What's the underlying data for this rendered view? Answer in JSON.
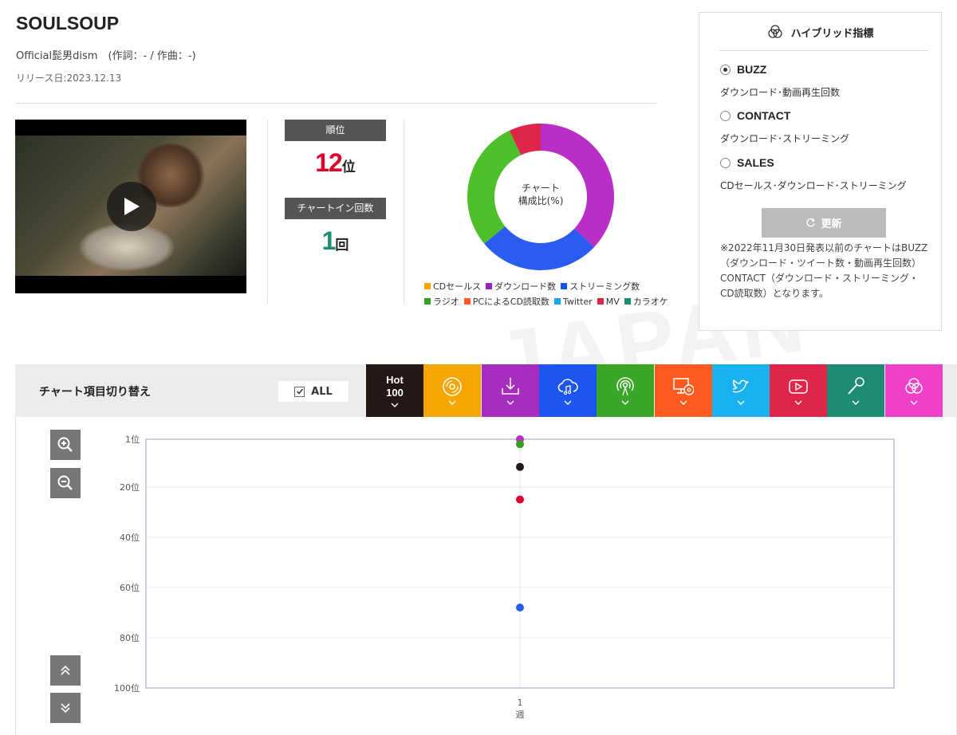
{
  "song": {
    "title": "SOULSOUP",
    "artist_line": "Official髭男dism　(作詞：- / 作曲：-)",
    "release": "リリース日:2023.12.13"
  },
  "video": {
    "icon": "play-icon"
  },
  "rank": {
    "label": "順位",
    "value": "12",
    "unit": "位",
    "value_color": "#e0002c",
    "chartin_label": "チャートイン回数",
    "chartin_value": "1",
    "chartin_unit": "回",
    "chartin_color": "#1c8c74"
  },
  "donut": {
    "center_line1": "チャート",
    "center_line2": "構成比(%)",
    "segments": [
      {
        "name": "ダウンロード数",
        "color": "#b82ec6",
        "value": 37
      },
      {
        "name": "ストリーミング数",
        "color": "#2a5cf0",
        "value": 27
      },
      {
        "name": "ラジオ",
        "color": "#4cbf2b",
        "value": 29
      },
      {
        "name": "MV",
        "color": "#e0254a",
        "value": 7
      }
    ]
  },
  "legend": {
    "row1": [
      {
        "label": "CDセールス",
        "color": "#f7a500"
      },
      {
        "label": "ダウンロード数",
        "color": "#a020c0"
      },
      {
        "label": "ストリーミング数",
        "color": "#1452f0"
      }
    ],
    "row2": [
      {
        "label": "ラジオ",
        "color": "#33a020"
      },
      {
        "label": "PCによるCD読取数",
        "color": "#ff5a1f"
      },
      {
        "label": "Twitter",
        "color": "#19a8f0"
      },
      {
        "label": "MV",
        "color": "#e0254a"
      },
      {
        "label": "カラオケ",
        "color": "#1c8c74"
      }
    ]
  },
  "hybrid": {
    "title": "ハイブリッド指標",
    "options": [
      {
        "label": "BUZZ",
        "desc": "ダウンロード･動画再生回数",
        "selected": true
      },
      {
        "label": "CONTACT",
        "desc": "ダウンロード･ストリーミング",
        "selected": false
      },
      {
        "label": "SALES",
        "desc": "CDセールス･ダウンロード･ストリーミング",
        "selected": false
      }
    ],
    "refresh_label": "更新",
    "note": "※2022年11月30日発表以前のチャートはBUZZ（ダウンロード・ツイート数・動画再生回数）CONTACT（ダウンロード・ストリーミング・CD読取数）となります。"
  },
  "toolbar": {
    "title": "チャート項目切り替え",
    "all_label": "ALL",
    "tabs": [
      {
        "name": "hot100",
        "label": "Hot\n100",
        "color": "#231816",
        "icon": "hot-100-label"
      },
      {
        "name": "cd-sales",
        "color": "#f7a500",
        "icon": "cd-icon"
      },
      {
        "name": "download",
        "color": "#a72cc0",
        "icon": "download-icon"
      },
      {
        "name": "streaming",
        "color": "#1c55f0",
        "icon": "cloud-music-icon"
      },
      {
        "name": "radio",
        "color": "#3aa628",
        "icon": "broadcast-icon"
      },
      {
        "name": "pc-cd-read",
        "color": "#ff5a1f",
        "icon": "pc-cd-icon"
      },
      {
        "name": "twitter",
        "color": "#19b2f0",
        "icon": "twitter-icon"
      },
      {
        "name": "mv",
        "color": "#e0254a",
        "icon": "youtube-icon"
      },
      {
        "name": "karaoke",
        "color": "#1c8c74",
        "icon": "microphone-icon"
      },
      {
        "name": "hybrid",
        "color": "#ee40c8",
        "icon": "hybrid-icon"
      }
    ]
  },
  "chart_data": {
    "type": "scatter",
    "y_ticks": [
      "1位",
      "20位",
      "40位",
      "60位",
      "80位",
      "100位"
    ],
    "y_tick_values": [
      1,
      20,
      40,
      60,
      80,
      100
    ],
    "ylim": [
      1,
      100
    ],
    "y_inverted": true,
    "x_tick_line1": "1",
    "x_tick_line2": "週",
    "grid": true,
    "points": [
      {
        "x": 1,
        "y": 1,
        "color": "#b82ec6"
      },
      {
        "x": 1,
        "y": 3,
        "color": "#33a020"
      },
      {
        "x": 1,
        "y": 12,
        "color": "#231816"
      },
      {
        "x": 1,
        "y": 25,
        "color": "#e0002c"
      },
      {
        "x": 1,
        "y": 68,
        "color": "#2a5cf0"
      }
    ]
  }
}
